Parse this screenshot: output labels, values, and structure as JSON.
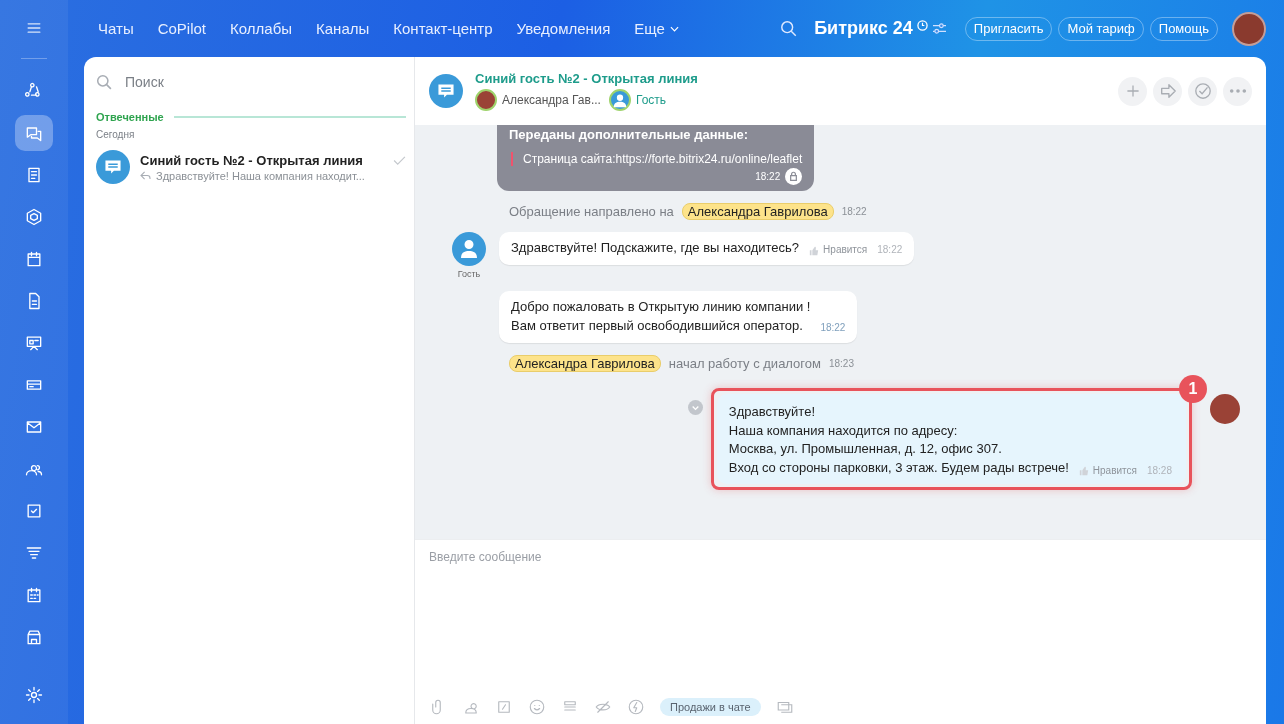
{
  "rail": [
    {
      "selected": false
    },
    {
      "selected": false
    },
    {
      "selected": true
    },
    {
      "selected": false
    },
    {
      "selected": false
    },
    {
      "selected": false
    },
    {
      "selected": false
    },
    {
      "selected": false
    },
    {
      "selected": false
    },
    {
      "selected": false
    },
    {
      "selected": false
    },
    {
      "selected": false
    },
    {
      "selected": false
    },
    {
      "selected": false
    },
    {
      "selected": false
    },
    {
      "selected": false
    }
  ],
  "top_nav": [
    {
      "label": "Чаты",
      "dropdown": false
    },
    {
      "label": "CoPilot",
      "dropdown": false
    },
    {
      "label": "Коллабы",
      "dropdown": false
    },
    {
      "label": "Каналы",
      "dropdown": false
    },
    {
      "label": "Контакт-центр",
      "dropdown": false
    },
    {
      "label": "Уведомления",
      "dropdown": false
    },
    {
      "label": "Еще",
      "dropdown": true
    }
  ],
  "logo": {
    "name": "Битрикс",
    "number": "24"
  },
  "header_buttons": [
    "Пригласить",
    "Мой тариф",
    "Помощь"
  ],
  "search": {
    "placeholder": "Поиск"
  },
  "recent": {
    "section": "Отвеченные",
    "date_group": "Сегодня",
    "chats": [
      {
        "title": "Синий гость №2 - Открытая линия",
        "preview": "Здравствуйте! Наша компания находит...",
        "selected": false,
        "read": true
      }
    ]
  },
  "dialog": {
    "title": "Синий гость №2 - Открытая линия",
    "members": [
      {
        "name": "Александра Гав...",
        "kind": "operator"
      },
      {
        "name": "Гость",
        "kind": "guest"
      }
    ]
  },
  "messages": [
    {
      "kind": "data",
      "heading": "Переданы дополнительные данные:",
      "line": "Страница сайта:https://forte.bitrix24.ru/online/leaflet",
      "time": "18:22"
    },
    {
      "kind": "forward",
      "text": "Обращение направлено на",
      "person": "Александра Гаврилова",
      "time": "18:22"
    },
    {
      "kind": "incoming",
      "author": "Гость",
      "lines": [
        "Здравствуйте! Подскажите, где вы находитесь?"
      ],
      "like": "Нравится",
      "time": "18:22"
    },
    {
      "kind": "system",
      "lines": [
        "Добро пожаловать в Открытую линию компании !",
        "Вам ответит первый освободившийся оператор."
      ],
      "time": "18:22"
    },
    {
      "kind": "joined",
      "person": "Александра Гаврилова",
      "text": "начал работу с диалогом",
      "time": "18:23"
    },
    {
      "kind": "outgoing",
      "lines": [
        "Здравствуйте!",
        "Наша компания находится по адресу:",
        "Москва, ул. Промышленная, д. 12, офис 307.",
        "Вход со стороны парковки, 3 этаж. Будем рады встрече!"
      ],
      "like": "Нравится",
      "time": "18:28",
      "highlighted": true,
      "badge": "1"
    }
  ],
  "composer": {
    "placeholder": "Введите сообщение",
    "sales_button": "Продажи в чате"
  }
}
